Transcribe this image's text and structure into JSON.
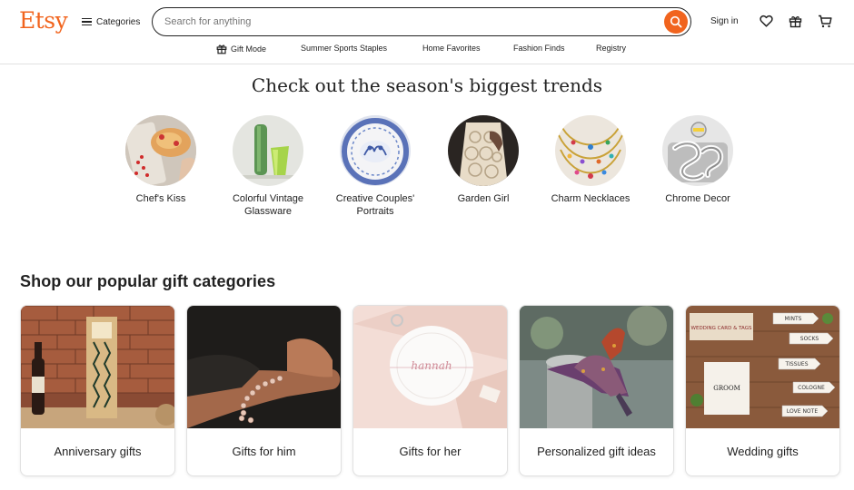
{
  "brand": {
    "logo_text": "Etsy",
    "accent_color": "#f1641e"
  },
  "header": {
    "categories_label": "Categories",
    "search_placeholder": "Search for anything",
    "signin_label": "Sign in",
    "icons": [
      "heart-icon",
      "gift-icon",
      "cart-icon"
    ]
  },
  "subnav": {
    "items": [
      {
        "label": "Gift Mode",
        "icon": "gift-icon"
      },
      {
        "label": "Summer Sports Staples"
      },
      {
        "label": "Home Favorites"
      },
      {
        "label": "Fashion Finds"
      },
      {
        "label": "Registry"
      }
    ]
  },
  "trends": {
    "title": "Check out the season's biggest trends",
    "items": [
      {
        "label": "Chef's Kiss"
      },
      {
        "label": "Colorful Vintage Glassware"
      },
      {
        "label": "Creative Couples' Portraits"
      },
      {
        "label": "Garden Girl"
      },
      {
        "label": "Charm Necklaces"
      },
      {
        "label": "Chrome Decor"
      }
    ]
  },
  "gifts": {
    "title": "Shop our popular gift categories",
    "items": [
      {
        "label": "Anniversary gifts"
      },
      {
        "label": "Gifts for him"
      },
      {
        "label": "Gifts for her",
        "image_text": "hannah"
      },
      {
        "label": "Personalized gift ideas"
      },
      {
        "label": "Wedding gifts",
        "image_texts": [
          "WEDDING CARD & TAGS",
          "MINTS",
          "SOCKS",
          "TISSUES",
          "GROOM",
          "COLOGNE",
          "LOVE NOTE"
        ]
      }
    ]
  }
}
